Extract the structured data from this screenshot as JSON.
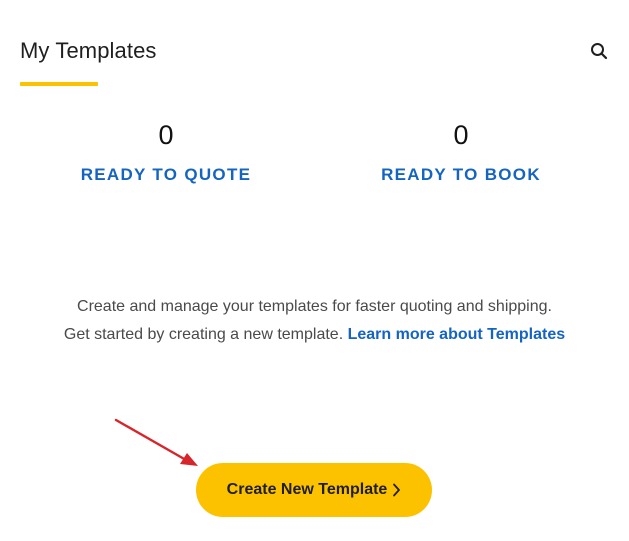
{
  "header": {
    "title": "My Templates",
    "search_icon": "search-icon"
  },
  "stats": [
    {
      "count": "0",
      "label": "READY TO QUOTE"
    },
    {
      "count": "0",
      "label": "READY TO BOOK"
    }
  ],
  "description": {
    "line1": "Create and manage your templates for faster quoting and shipping.",
    "line2": "Get started by creating a new template. ",
    "link": "Learn more about Templates"
  },
  "cta": {
    "label": "Create New Template",
    "icon": "chevron-right-icon"
  },
  "colors": {
    "accent": "#fcc200",
    "link": "#1565c0",
    "annotation_arrow": "#d7262b"
  }
}
